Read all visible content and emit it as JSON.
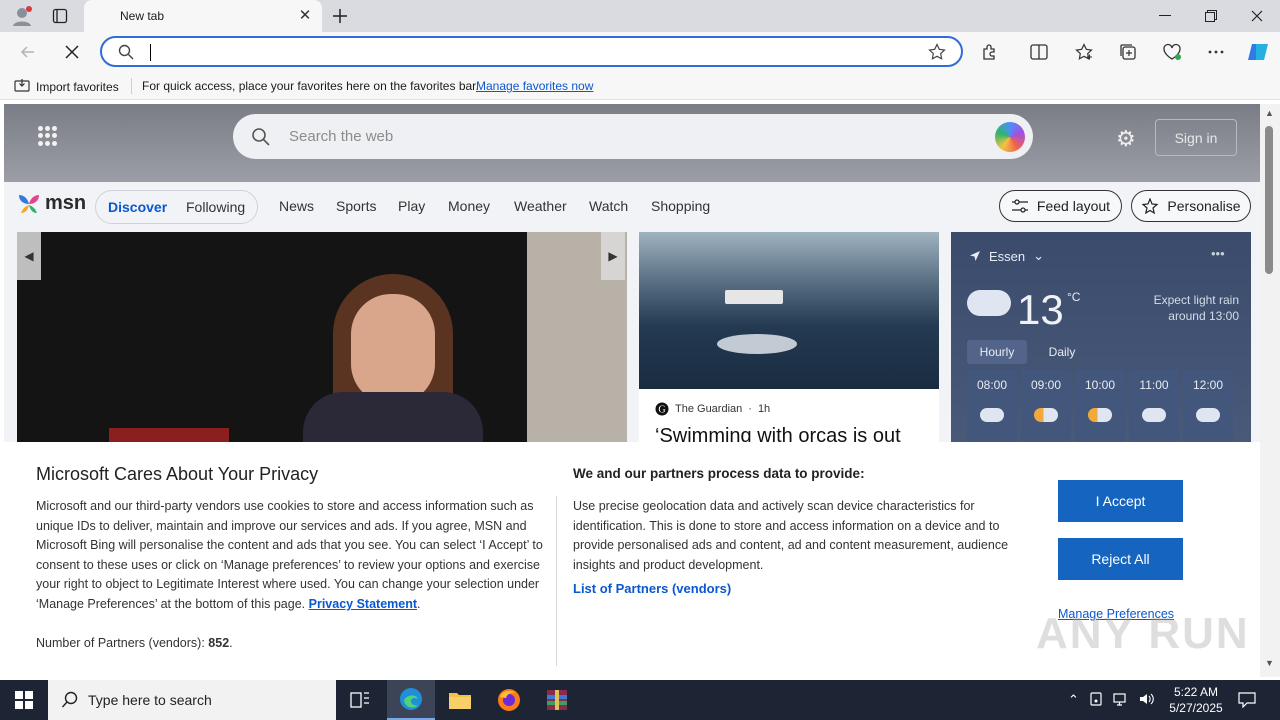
{
  "browser": {
    "tab_title": "New tab",
    "address_value": "",
    "fav_import_label": "Import favorites",
    "fav_message": "For quick access, place your favorites here on the favorites bar.",
    "fav_manage_link": "Manage favorites now"
  },
  "msn": {
    "search_placeholder": "Search the web",
    "signin_label": "Sign in",
    "logo_text": "msn",
    "pill": {
      "discover": "Discover",
      "following": "Following"
    },
    "nav": [
      "News",
      "Sports",
      "Play",
      "Money",
      "Weather",
      "Watch",
      "Shopping"
    ],
    "feed_layout_label": "Feed layout",
    "personalise_label": "Personalise",
    "card": {
      "source": "The Guardian",
      "age": "1h",
      "headline": "‘Swimming with orcas is out"
    },
    "weather": {
      "location": "Essen",
      "temperature": "13",
      "unit": "°C",
      "forecast_line1": "Expect light rain",
      "forecast_line2": "around 13:00",
      "tab_hourly": "Hourly",
      "tab_daily": "Daily",
      "hours": [
        "08:00",
        "09:00",
        "10:00",
        "11:00",
        "12:00"
      ],
      "hour_icons": [
        "cloud-icon",
        "partly-sunny-icon",
        "partly-sunny-icon",
        "cloud-icon",
        "cloud-icon"
      ]
    }
  },
  "privacy": {
    "title": "Microsoft Cares About Your Privacy",
    "body": "Microsoft and our third-party vendors use cookies to store and access information such as unique IDs to deliver, maintain and improve our services and ads. If you agree, MSN and Microsoft Bing will personalise the content and ads that you see. You can select ‘I Accept’ to consent to these uses or click on ‘Manage preferences’ to review your options and exercise your right to object to Legitimate Interest where used.  You can change your selection under ‘Manage Preferences’ at the bottom of this page.",
    "privacy_link": "Privacy Statement",
    "partners_label": "Number of Partners (vendors):",
    "partners_count": "852",
    "heading2": "We and our partners process data to provide:",
    "body2": "Use precise geolocation data and actively scan device characteristics for identification. This is done to store and access information on a device and to provide personalised ads and content, ad and content measurement, audience insights and product development.",
    "vendors_link": "List of Partners (vendors)",
    "accept_label": "I Accept",
    "reject_label": "Reject All",
    "manage_label": "Manage Preferences"
  },
  "watermark": "ANY RUN",
  "taskbar": {
    "search_placeholder": "Type here to search",
    "time": "5:22 AM",
    "date": "5/27/2025"
  },
  "colors": {
    "accent": "#1565c0",
    "link": "#0b57d0",
    "taskbar": "#1d2433"
  }
}
